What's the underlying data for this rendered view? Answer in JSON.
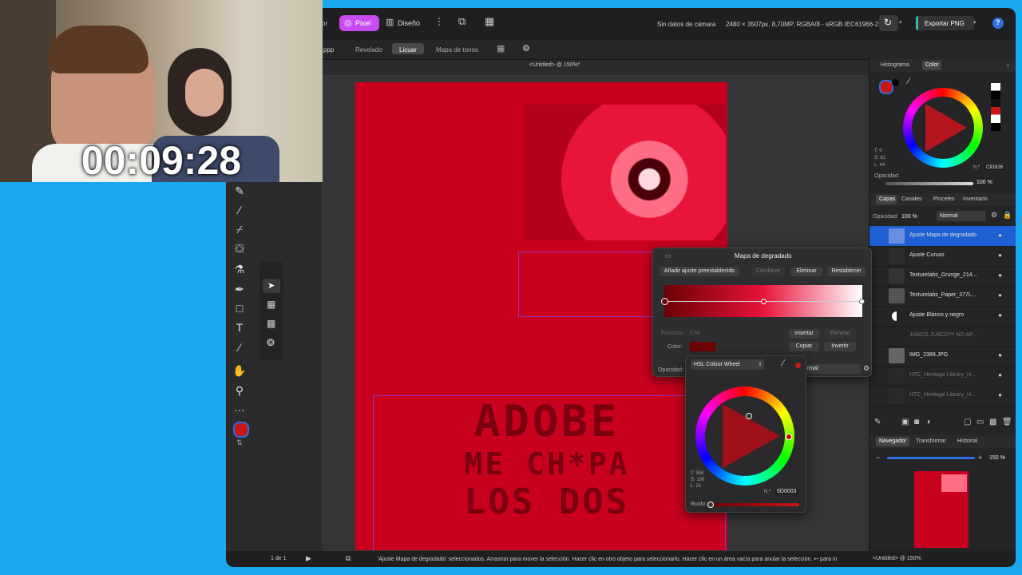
{
  "stream": {
    "timer": "00:09:28"
  },
  "topbar": {
    "persona_partial": "or",
    "persona_pixel": "Pixel",
    "persona_design": "Diseño",
    "camera_info": "Sin datos de cámara",
    "doc_info": "2480 × 3507px, 8,70MP, RGBA/8 - sRGB IEC61966-2.1",
    "export_label": "Exportar PNG",
    "help": "?"
  },
  "ctxbar": {
    "partial": "ppp",
    "items": [
      "Revelado",
      "Licuar",
      "Mapa de tonos"
    ],
    "active_index": 1
  },
  "doc_title": "<Untitled> @ 150%*",
  "artwork": {
    "line1": "ADOBE",
    "line2": "ME CH*PA",
    "line3": "LOS DOS"
  },
  "right": {
    "tabs_top": [
      "Histograma",
      "Color"
    ],
    "color": {
      "t": "T: 0",
      "s": "S: 81",
      "l": "L: 44",
      "hex_label": "N.º",
      "hex": "C91616",
      "opacity_label": "Opacidad",
      "opacity_value": "100 %"
    },
    "layer_tabs": [
      "Capas",
      "Canales",
      "Pinceles",
      "Inventario"
    ],
    "opacity_label": "Opacidad:",
    "opacity_value": "100 %",
    "blend_mode": "Normal",
    "layers": [
      {
        "name": "Ajuste Mapa de degradado",
        "selected": true
      },
      {
        "name": "Ajuste Curvas",
        "selected": false
      },
      {
        "name": "Texturelabs_Grunge_214...",
        "selected": false
      },
      {
        "name": "Texturelabs_Paper_377L...",
        "selected": false
      },
      {
        "name": "Ajuste Blanco y negro",
        "selected": false
      },
      {
        "name": "JUACO JUACO™ NO AP...",
        "selected": false,
        "dim": true
      },
      {
        "name": "IMG_2389.JPG",
        "selected": false
      },
      {
        "name": "HTC_Heritage Library_H...",
        "selected": false,
        "dim": true
      },
      {
        "name": "HTC_Heritage Library_H...",
        "selected": false,
        "dim": true
      }
    ],
    "nav_tabs": [
      "Navegador",
      "Transformar",
      "Historial"
    ],
    "zoom": "150 %"
  },
  "dialog": {
    "title": "Mapa de degradado",
    "add_preset": "Añadir ajuste preestablecido",
    "combine": "Combinar",
    "delete": "Eliminar",
    "reset": "Restablecer",
    "position_label": "Posición:",
    "position_value": "0 %",
    "insert": "Insertar",
    "remove": "Eliminar",
    "color_label": "Color:",
    "copy": "Copiar",
    "invert": "Invertir",
    "opacity_label": "Opacidad:",
    "blend_partial": "rmal"
  },
  "wheel_popup": {
    "mode": "HSL Colour Wheel",
    "t": "T: 358",
    "s": "S: 100",
    "l": "L: 21",
    "hex_label": "N.º",
    "hex": "6D0003",
    "noise_label": "Ruido"
  },
  "statusbar": {
    "page": "1 de 1",
    "message": "'Ajuste Mapa de degradado' seleccionados. Arrastrar para mover la selección. Hacer clic en otro objeto para seleccionarlo. Hacer clic en un área vacía para anular la selección. ↩ para in",
    "doc": "<Untitled> @ 150%"
  },
  "colors": {
    "accent": "#c84bf0",
    "export": "#2dbfa0",
    "primary": "#c91616",
    "grad_start": "#6d0003",
    "grad_mid": "#e8143a",
    "grad_end": "#ffffff"
  }
}
